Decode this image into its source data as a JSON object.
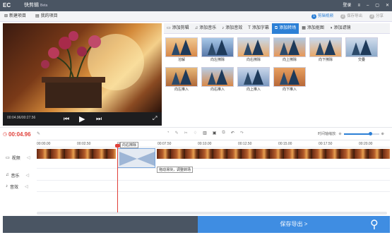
{
  "app": {
    "logo_text": "EC",
    "name": "快剪辑",
    "version": "Beta",
    "login": "登录"
  },
  "toolbar": {
    "new_project": "新建项目",
    "my_projects": "我的项目"
  },
  "steps": [
    {
      "num": "1",
      "label": "剪辑视频"
    },
    {
      "num": "2",
      "label": "保存导出"
    },
    {
      "num": "3",
      "label": "分享"
    }
  ],
  "preview": {
    "time": "00:04.96/00:27.56"
  },
  "tabs": [
    {
      "label": "添加剪辑",
      "icon": "film-icon"
    },
    {
      "label": "添加音乐",
      "icon": "music-icon"
    },
    {
      "label": "添加音效",
      "icon": "sound-icon"
    },
    {
      "label": "添加字幕",
      "icon": "text-icon"
    },
    {
      "label": "添加转场",
      "icon": "transition-icon"
    },
    {
      "label": "添加抠图",
      "icon": "cutout-icon"
    },
    {
      "label": "添加滤镜",
      "icon": "filter-icon"
    }
  ],
  "transitions": [
    "溶解",
    "向左擦除",
    "向右擦除",
    "向上擦除",
    "向下擦除",
    "交叠",
    "向左推入",
    "向右推入",
    "向上推入",
    "向下推入"
  ],
  "timeline": {
    "current": "00:04.96",
    "zoom_label": "时间轴缩放:",
    "zoom_level": 0.75,
    "ruler": [
      "00:00.00",
      "00:02.50",
      "00:05.00",
      "00:07.50",
      "00:10.00",
      "00:12.50",
      "00:15.00",
      "00:17.50",
      "00:20.00"
    ],
    "tooltip1": "向右擦除",
    "tooltip2": "拖动滑块，调整转场",
    "tracks": [
      "视频",
      "音乐",
      "音效"
    ]
  },
  "save_label": "保存导出 >"
}
